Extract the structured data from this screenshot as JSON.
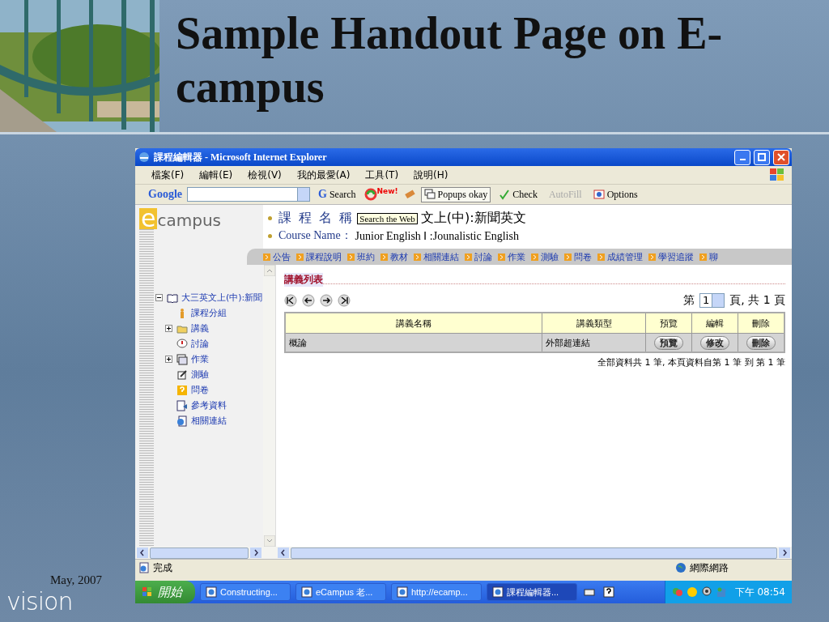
{
  "slide": {
    "title": "Sample Handout Page on E-campus",
    "date": "May, 2007",
    "logo_text": "vision"
  },
  "window": {
    "title": "課程編輯器 - Microsoft Internet Explorer"
  },
  "menu": [
    "檔案(F)",
    "編輯(E)",
    "檢視(V)",
    "我的最愛(A)",
    "工具(T)",
    "說明(H)"
  ],
  "google_toolbar": {
    "brand": "Google",
    "search_icon": "G",
    "search_button": "Search",
    "new_badge": "New!",
    "popups": "Popups okay",
    "check": "Check",
    "autofill": {
      "label": "AutoFill",
      "disabled": true
    },
    "options": "Options"
  },
  "logo": {
    "mark": "e",
    "text": "campus"
  },
  "course": {
    "label_zh": "課 程 名 稱",
    "tooltip": "Search the Web",
    "name_zh": "文上(中):新聞英文",
    "label_en": "Course Name：",
    "name_en": "Junior English Ⅰ :Jounalistic English"
  },
  "nav_tabs": [
    "公告",
    "課程說明",
    "班約",
    "教材",
    "相關連結",
    "討論",
    "作業",
    "測驗",
    "問卷",
    "成績管理",
    "學習追蹤",
    "聊"
  ],
  "tree": {
    "label": "大三英文上(中):新聞",
    "has_children": true,
    "expanded": true,
    "children": [
      {
        "label": "課程分組",
        "kind": "person",
        "has_children": false
      },
      {
        "label": "講義",
        "kind": "folder",
        "has_children": true,
        "expanded": false
      },
      {
        "label": "討論",
        "kind": "discussion",
        "has_children": false
      },
      {
        "label": "作業",
        "kind": "window",
        "has_children": true,
        "expanded": false
      },
      {
        "label": "測驗",
        "kind": "pencil",
        "has_children": false
      },
      {
        "label": "問卷",
        "kind": "question",
        "has_children": false
      },
      {
        "label": "參考資料",
        "kind": "document",
        "has_children": false
      },
      {
        "label": "相關連結",
        "kind": "link",
        "has_children": false
      }
    ]
  },
  "section_title": "講義列表",
  "pager": {
    "prefix": "第",
    "page": "1",
    "suffix": "頁, 共 1 頁"
  },
  "table": {
    "columns": [
      "講義名稱",
      "講義類型",
      "預覽",
      "編輯",
      "刪除"
    ],
    "rows": [
      {
        "name": "概論",
        "type": "外部超連結",
        "preview": "預覽",
        "edit": "修改",
        "delete": "刪除"
      }
    ]
  },
  "summary": "全部資料共 1 筆, 本頁資料自第 1 筆 到 第 1 筆",
  "status_bar": {
    "text": "完成",
    "zone": "網際網路"
  },
  "taskbar": {
    "start": "開始",
    "tasks": [
      {
        "label": "Constructing...",
        "selected": false
      },
      {
        "label": "eCampus 老...",
        "selected": false
      },
      {
        "label": "http://ecamp...",
        "selected": false
      },
      {
        "label": "課程編輯器...",
        "selected": true
      }
    ],
    "clock": "下午 08:54"
  }
}
